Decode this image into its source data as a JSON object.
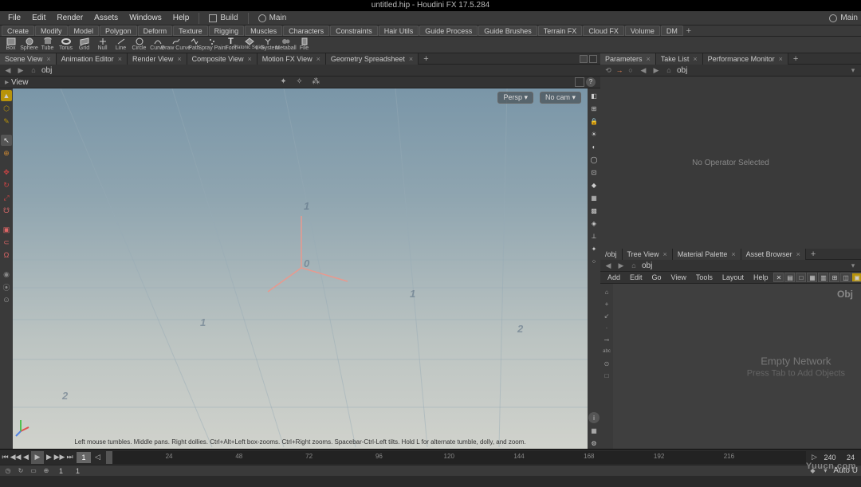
{
  "window": {
    "title": "untitled.hip - Houdini FX 17.5.284"
  },
  "menubar": {
    "items": [
      "File",
      "Edit",
      "Render",
      "Assets",
      "Windows",
      "Help"
    ],
    "build": "Build",
    "main": "Main",
    "main_right": "Main"
  },
  "shelftabs": [
    "Create",
    "Modify",
    "Model",
    "Polygon",
    "Deform",
    "Texture",
    "Rigging",
    "Muscles",
    "Characters",
    "Constraints",
    "Hair Utils",
    "Guide Process",
    "Guide Brushes",
    "Terrain FX",
    "Cloud FX",
    "Volume",
    "DM"
  ],
  "tools": [
    {
      "label": "Box"
    },
    {
      "label": "Sphere"
    },
    {
      "label": "Tube"
    },
    {
      "label": "Torus"
    },
    {
      "label": "Grid"
    },
    {
      "label": "Null"
    },
    {
      "label": "Line"
    },
    {
      "label": "Circle"
    },
    {
      "label": "Curve"
    },
    {
      "label": "Draw Curve"
    },
    {
      "label": "Path"
    },
    {
      "label": "Spray Paint"
    },
    {
      "label": "Font"
    },
    {
      "label": "Platonic Solids"
    },
    {
      "label": "L-System"
    },
    {
      "label": "Metaball"
    },
    {
      "label": "File"
    }
  ],
  "left_pane_tabs": [
    "Scene View",
    "Animation Editor",
    "Render View",
    "Composite View",
    "Motion FX View",
    "Geometry Spreadsheet"
  ],
  "path": "obj",
  "viewlabel": "View",
  "persp": "Persp",
  "cam": "No cam",
  "hint": "Left mouse tumbles. Middle pans. Right dollies. Ctrl+Alt+Left box-zooms. Ctrl+Right zooms. Spacebar-Ctrl-Left tilts. Hold L for alternate tumble, dolly, and zoom.",
  "right_top_tabs": [
    "Parameters",
    "Take List",
    "Performance Monitor"
  ],
  "no_op": "No Operator Selected",
  "right_bot_tabs": [
    "Tree View",
    "Material Palette",
    "Asset Browser"
  ],
  "right_bot_crumb": "/obj",
  "net_menu": [
    "Add",
    "Edit",
    "Go",
    "View",
    "Tools",
    "Layout",
    "Help"
  ],
  "net_corner": "Obj",
  "empty1": "Empty Network",
  "empty2": "Press Tab to Add Objects",
  "timeline": {
    "current": "1",
    "ticks": [
      "24",
      "48",
      "72",
      "96",
      "120",
      "144",
      "168",
      "192",
      "216"
    ],
    "end1": "240",
    "end2": "24"
  },
  "status": {
    "start": "1",
    "global_start": "1",
    "auto": "Auto U"
  },
  "watermark": "Yuucn.com"
}
